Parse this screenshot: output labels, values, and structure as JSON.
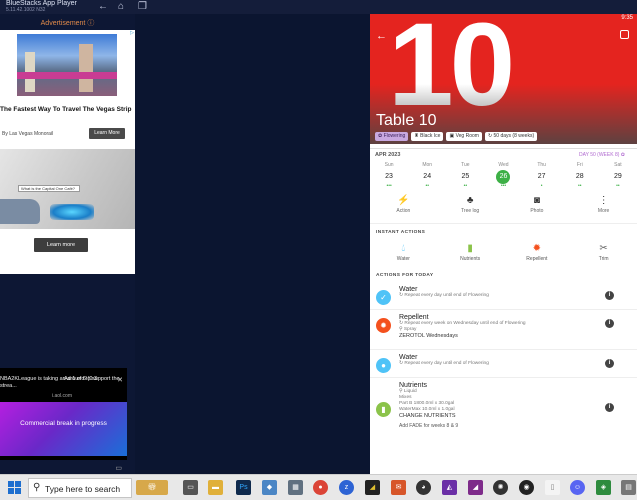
{
  "window": {
    "title": "BlueStacks App Player",
    "version": "5.11.42.1002 N32"
  },
  "ads": {
    "label": "Advertisement",
    "ad1": {
      "headline": "The Fastest Way To Travel The Vegas Strip",
      "sponsor": "By Las Vegas Monorail",
      "button": "Learn More"
    },
    "ad2": {
      "search_text": "What is the Capital One Café?",
      "button": "Learn more"
    },
    "video": {
      "caption": "NBA2KLeague is taking an around to support the strea...",
      "counter": "Ad 1 of 6 (0:3",
      "source": "i.aol.com",
      "message": "Commercial break in progress"
    }
  },
  "app": {
    "status_time": "9:35",
    "title": "Table 10",
    "hero_number": "10",
    "chips": [
      "Flowering",
      "Black Ice",
      "Veg Room",
      "50 days (8 weeks)"
    ],
    "week_header": {
      "month": "APR 2023",
      "info": "DAY 50 (WEEK 8)"
    },
    "days": [
      {
        "name": "Sun",
        "date": "23",
        "dots": "•••"
      },
      {
        "name": "Mon",
        "date": "24",
        "dots": "••"
      },
      {
        "name": "Tue",
        "date": "25",
        "dots": "••"
      },
      {
        "name": "Wed",
        "date": "26",
        "dots": "•••"
      },
      {
        "name": "Thu",
        "date": "27",
        "dots": "•"
      },
      {
        "name": "Fri",
        "date": "28",
        "dots": "••"
      },
      {
        "name": "Sat",
        "date": "29",
        "dots": "••"
      }
    ],
    "quick_actions": [
      "Action",
      "Tree log",
      "Photo",
      "More"
    ],
    "instant_header": "INSTANT ACTIONS",
    "instant_actions": [
      "Water",
      "Nutrients",
      "Repellent",
      "Trim"
    ],
    "today_header": "ACTIONS FOR TODAY",
    "tasks": [
      {
        "title": "Water",
        "line1": "Repeat every day until end of Flowering"
      },
      {
        "title": "Repellent",
        "line1": "Repeat every week on Wednesday until end of Flowering",
        "line2": "Spray",
        "line3": "ZEROTOL Wednesdays"
      },
      {
        "title": "Water",
        "line1": "Repeat every day until end of Flowering"
      },
      {
        "title": "Nutrients",
        "line1": "Liquid",
        "line2": "Mixes",
        "line3": "Part B 1800.0ml x 30.0gal",
        "line4": "WaterMax 10.0ml x 1.0gal",
        "line5": "CHANGE NUTRIENTS",
        "line6": "Add FADE for weeks 8 & 9"
      }
    ]
  },
  "taskbar": {
    "search_placeholder": "Type here to search"
  },
  "colors": {
    "hero": "#e4241f",
    "selected_day": "#3db046",
    "water": "#4fc3f7",
    "repellent": "#f4511e",
    "nutrients": "#8bc34a"
  }
}
